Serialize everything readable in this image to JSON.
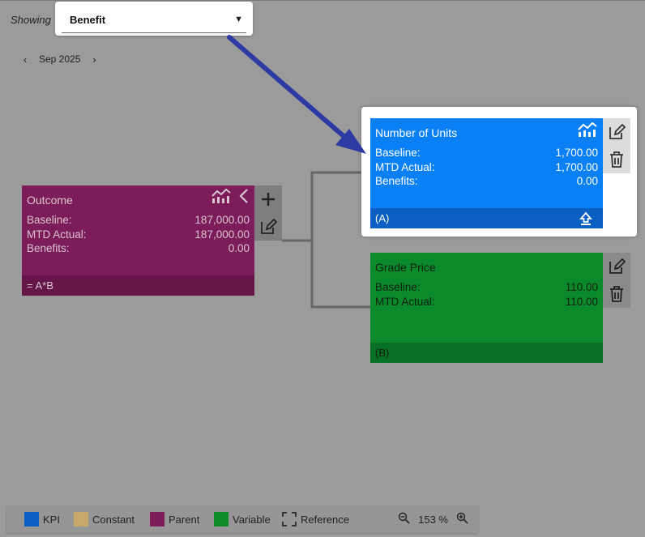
{
  "header": {
    "showing_label": "Showing",
    "dropdown_value": "Benefit",
    "dropdown_caret": "▼",
    "month": "Sep 2025",
    "prev": "‹",
    "next": "›"
  },
  "nodes": {
    "kpi": {
      "title": "Number of Units",
      "rows": [
        {
          "label": "Baseline:",
          "value": "1,700.00"
        },
        {
          "label": "MTD Actual:",
          "value": "1,700.00"
        },
        {
          "label": "Benefits:",
          "value": "0.00"
        }
      ],
      "footer": "(A)",
      "color": "#0a80f7"
    },
    "outcome": {
      "title": "Outcome",
      "rows": [
        {
          "label": "Baseline:",
          "value": "187,000.00"
        },
        {
          "label": "MTD Actual:",
          "value": "187,000.00"
        },
        {
          "label": "Benefits:",
          "value": "0.00"
        }
      ],
      "footer": "= A*B",
      "color": "#7c1d5a"
    },
    "variable": {
      "title": "Grade Price",
      "rows": [
        {
          "label": "Baseline:",
          "value": "110.00"
        },
        {
          "label": "MTD Actual:",
          "value": "110.00"
        }
      ],
      "footer": "(B)",
      "color": "#0b8a2b"
    }
  },
  "legend": {
    "items": [
      {
        "label": "KPI",
        "color": "#0b5ec2"
      },
      {
        "label": "Constant",
        "color": "#c8a86a"
      },
      {
        "label": "Parent",
        "color": "#7c1d5a"
      },
      {
        "label": "Variable",
        "color": "#0b8a2b"
      },
      {
        "label": "Reference",
        "color": "dashed"
      }
    ],
    "zoom": "153 %"
  },
  "icons": [
    "chart-icon",
    "chevron-left-icon",
    "edit-icon",
    "trash-icon",
    "plus-icon",
    "upload-icon",
    "zoom-out-icon",
    "zoom-in-icon",
    "annotation-arrow"
  ]
}
